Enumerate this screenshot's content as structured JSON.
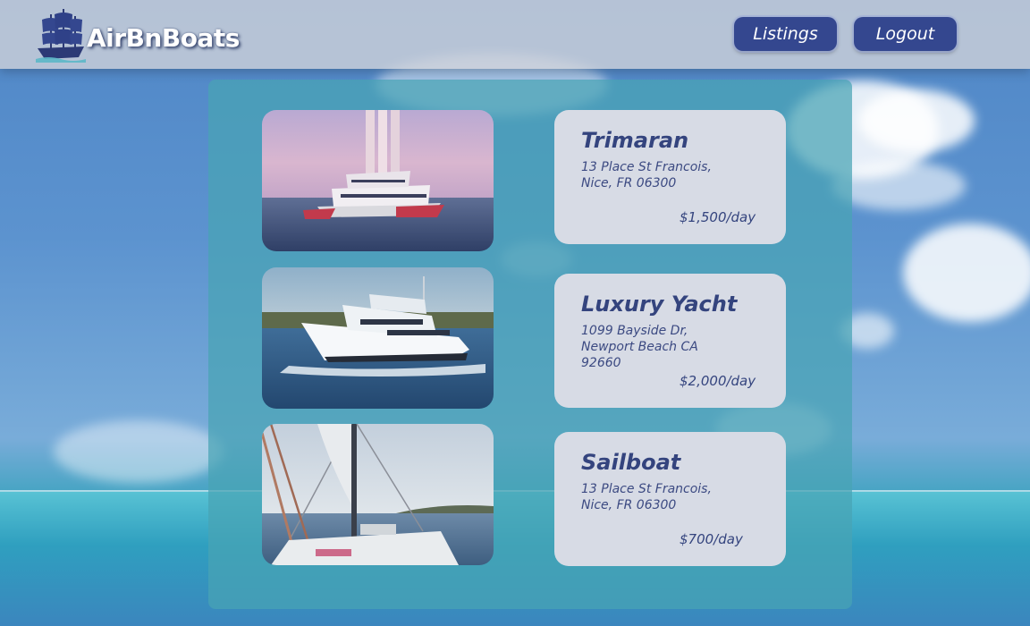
{
  "header": {
    "brand": "AirBnBoats",
    "logo_icon": "pirate-ship-icon",
    "nav": [
      {
        "label": "Listings"
      },
      {
        "label": "Logout"
      }
    ]
  },
  "listings": [
    {
      "title": "Trimaran",
      "address_lines": [
        "13 Place St Francois,",
        "Nice, FR 06300"
      ],
      "price": "$1,500/day",
      "photo_icon": "trimaran-photo"
    },
    {
      "title": "Luxury Yacht",
      "address_lines": [
        "1099 Bayside Dr,",
        "Newport Beach CA",
        "92660"
      ],
      "price": "$2,000/day",
      "photo_icon": "yacht-photo"
    },
    {
      "title": "Sailboat",
      "address_lines": [
        "13 Place St Francois,",
        "Nice, FR 06300"
      ],
      "price": "$700/day",
      "photo_icon": "sailboat-photo"
    }
  ],
  "colors": {
    "nav_button": "#34478f",
    "card_bg": "#d7dbe5",
    "card_text": "#34447e",
    "panel": "#48a3b4"
  }
}
